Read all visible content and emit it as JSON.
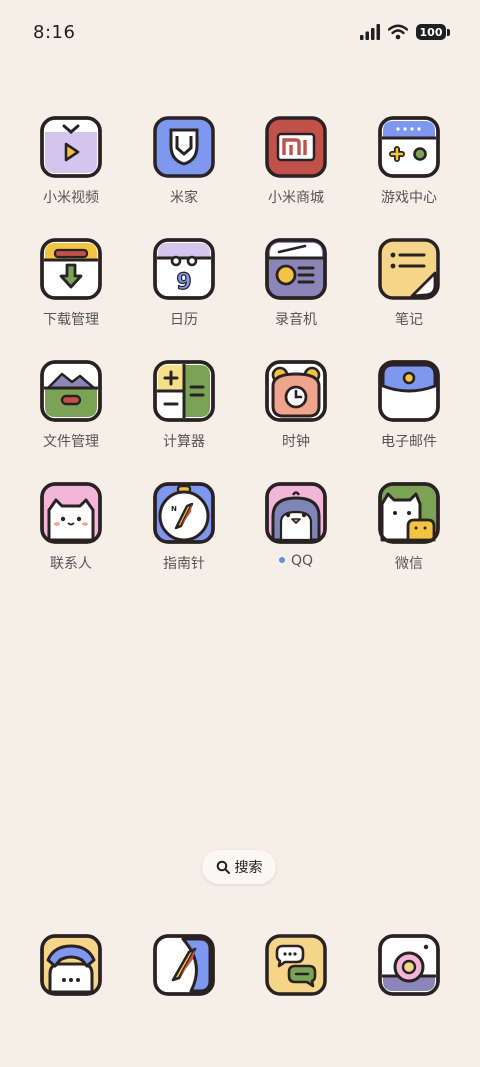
{
  "status": {
    "time": "8:16",
    "battery": "100"
  },
  "rows": [
    [
      {
        "label": "小米视频",
        "icon": "video-player-icon"
      },
      {
        "label": "米家",
        "icon": "mijia-icon"
      },
      {
        "label": "小米商城",
        "icon": "mi-store-icon"
      },
      {
        "label": "游戏中心",
        "icon": "gamepad-icon"
      }
    ],
    [
      {
        "label": "下载管理",
        "icon": "download-icon"
      },
      {
        "label": "日历",
        "icon": "calendar-icon"
      },
      {
        "label": "录音机",
        "icon": "radio-recorder-icon"
      },
      {
        "label": "笔记",
        "icon": "notes-icon"
      }
    ],
    [
      {
        "label": "文件管理",
        "icon": "folder-icon"
      },
      {
        "label": "计算器",
        "icon": "calculator-icon"
      },
      {
        "label": "时钟",
        "icon": "alarm-clock-icon"
      },
      {
        "label": "电子邮件",
        "icon": "envelope-icon"
      }
    ],
    [
      {
        "label": "联系人",
        "icon": "cat-contact-icon"
      },
      {
        "label": "指南针",
        "icon": "compass-icon"
      },
      {
        "label": "QQ",
        "icon": "penguin-icon",
        "new_dot": true
      },
      {
        "label": "微信",
        "icon": "cat-chat-icon"
      }
    ]
  ],
  "search": {
    "label": "搜索"
  },
  "dock": [
    {
      "icon": "phone-icon"
    },
    {
      "icon": "browser-compass-icon"
    },
    {
      "icon": "messages-icon"
    },
    {
      "icon": "camera-icon"
    }
  ]
}
